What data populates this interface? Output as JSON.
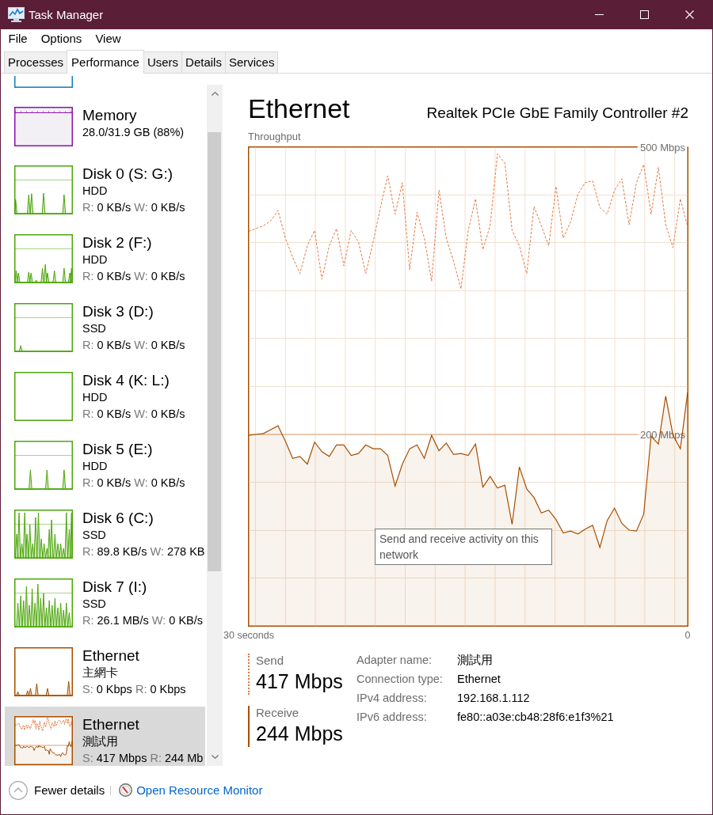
{
  "window": {
    "title": "Task Manager"
  },
  "menu": [
    "File",
    "Options",
    "View"
  ],
  "tabs": [
    {
      "label": "Processes",
      "selected": false
    },
    {
      "label": "Performance",
      "selected": true
    },
    {
      "label": "Users",
      "selected": false
    },
    {
      "label": "Details",
      "selected": false
    },
    {
      "label": "Services",
      "selected": false
    }
  ],
  "sidebar": {
    "items": [
      {
        "kind": "cpu",
        "selected": false
      },
      {
        "kind": "memory",
        "title": "Memory",
        "subtitle": "28.0/31.9 GB (88%)",
        "selected": false
      },
      {
        "kind": "disk",
        "title": "Disk 0 (S: G:)",
        "subtitle": "HDD",
        "rates": [
          {
            "label": "R:",
            "value": "0 KB/s"
          },
          {
            "label": "W:",
            "value": "0 KB/s"
          }
        ],
        "selected": false
      },
      {
        "kind": "disk",
        "title": "Disk 2 (F:)",
        "subtitle": "HDD",
        "rates": [
          {
            "label": "R:",
            "value": "0 KB/s"
          },
          {
            "label": "W:",
            "value": "0 KB/s"
          }
        ],
        "selected": false
      },
      {
        "kind": "disk",
        "title": "Disk 3 (D:)",
        "subtitle": "SSD",
        "rates": [
          {
            "label": "R:",
            "value": "0 KB/s"
          },
          {
            "label": "W:",
            "value": "0 KB/s"
          }
        ],
        "selected": false
      },
      {
        "kind": "disk",
        "title": "Disk 4 (K: L:)",
        "subtitle": "HDD",
        "rates": [
          {
            "label": "R:",
            "value": "0 KB/s"
          },
          {
            "label": "W:",
            "value": "0 KB/s"
          }
        ],
        "selected": false
      },
      {
        "kind": "disk",
        "title": "Disk 5 (E:)",
        "subtitle": "HDD",
        "rates": [
          {
            "label": "R:",
            "value": "0 KB/s"
          },
          {
            "label": "W:",
            "value": "0 KB/s"
          }
        ],
        "selected": false
      },
      {
        "kind": "disk",
        "title": "Disk 6 (C:)",
        "subtitle": "SSD",
        "rates": [
          {
            "label": "R:",
            "value": "89.8 KB/s"
          },
          {
            "label": "W:",
            "value": "278 KB"
          }
        ],
        "selected": false
      },
      {
        "kind": "disk",
        "title": "Disk 7 (I:)",
        "subtitle": "SSD",
        "rates": [
          {
            "label": "R:",
            "value": "26.1 MB/s"
          },
          {
            "label": "W:",
            "value": "0 KB/s"
          }
        ],
        "selected": false
      },
      {
        "kind": "ethernet",
        "title": "Ethernet",
        "subtitle": "主網卡",
        "rates": [
          {
            "label": "S:",
            "value": "0 Kbps"
          },
          {
            "label": "R:",
            "value": "0 Kbps"
          }
        ],
        "selected": false
      },
      {
        "kind": "ethernet",
        "title": "Ethernet",
        "subtitle": "測試用",
        "rates": [
          {
            "label": "S:",
            "value": "417 Mbps"
          },
          {
            "label": "R:",
            "value": "244 Mb"
          }
        ],
        "selected": true
      }
    ]
  },
  "performance": {
    "title": "Ethernet",
    "device": "Realtek PCIe GbE Family Controller #2",
    "chart_data": {
      "type": "line",
      "title": "Throughput",
      "x": [
        30,
        29.5,
        29,
        28.5,
        28,
        27.5,
        27,
        26.5,
        26,
        25.5,
        25,
        24.5,
        24,
        23.5,
        23,
        22.5,
        22,
        21.5,
        21,
        20.5,
        20,
        19.5,
        19,
        18.5,
        18,
        17.5,
        17,
        16.5,
        16,
        15.5,
        15,
        14.5,
        14,
        13.5,
        13,
        12.5,
        12,
        11.5,
        11,
        10.5,
        10,
        9.5,
        9,
        8.5,
        8,
        7.5,
        7,
        6.5,
        6,
        5.5,
        5,
        4.5,
        4,
        3.5,
        3,
        2.5,
        2,
        1.5,
        1,
        0.5,
        0
      ],
      "xlim": [
        30,
        0
      ],
      "ylim": [
        0,
        500
      ],
      "xticks": [
        {
          "value": 30,
          "label": "30 seconds"
        },
        {
          "value": 0,
          "label": "0"
        }
      ],
      "yticks": [
        {
          "value": 200,
          "label": "200 Mbps"
        },
        {
          "value": 500,
          "label": "500 Mbps"
        }
      ],
      "ref_lines": [
        {
          "axis": "y",
          "value": 200
        }
      ],
      "series": [
        {
          "color": "#e5773f",
          "line_style": "dashed",
          "values": [
            412,
            415,
            418,
            423,
            434,
            405,
            385,
            368,
            397,
            413,
            362,
            397,
            415,
            376,
            413,
            401,
            368,
            401,
            437,
            470,
            430,
            463,
            372,
            432,
            405,
            360,
            455,
            405,
            381,
            352,
            413,
            446,
            393,
            418,
            493,
            484,
            413,
            397,
            368,
            438,
            418,
            397,
            459,
            405,
            422,
            451,
            463,
            465,
            437,
            430,
            455,
            467,
            419,
            463,
            482,
            430,
            479,
            419,
            395,
            446,
            417
          ]
        },
        {
          "color": "#a74f01",
          "line_style": "solid",
          "values": [
            199,
            200,
            201,
            205,
            209,
            193,
            175,
            177,
            169,
            192,
            182,
            177,
            189,
            189,
            178,
            180,
            189,
            185,
            185,
            178,
            146,
            169,
            185,
            189,
            175,
            199,
            183,
            191,
            179,
            180,
            178,
            190,
            145,
            156,
            144,
            147,
            106,
            166,
            143,
            134,
            118,
            121,
            111,
            97,
            99,
            96,
            101,
            105,
            82,
            110,
            123,
            107,
            100,
            99,
            117,
            198,
            190,
            240,
            199,
            185,
            244
          ]
        }
      ]
    },
    "tooltip": "Send and receive activity on this network",
    "rates": [
      {
        "kind": "send",
        "label": "Send",
        "value": "417 Mbps"
      },
      {
        "kind": "receive",
        "label": "Receive",
        "value": "244 Mbps"
      }
    ],
    "properties": [
      {
        "label": "Adapter name:",
        "value": "測試用"
      },
      {
        "label": "Connection type:",
        "value": "Ethernet"
      },
      {
        "label": "IPv4 address:",
        "value": "192.168.1.112"
      },
      {
        "label": "IPv6 address:",
        "value": "fe80::a03e:cb48:28f6:e1f3%21"
      }
    ]
  },
  "footer": {
    "fewer_details": "Fewer details",
    "link": "Open Resource Monitor"
  }
}
